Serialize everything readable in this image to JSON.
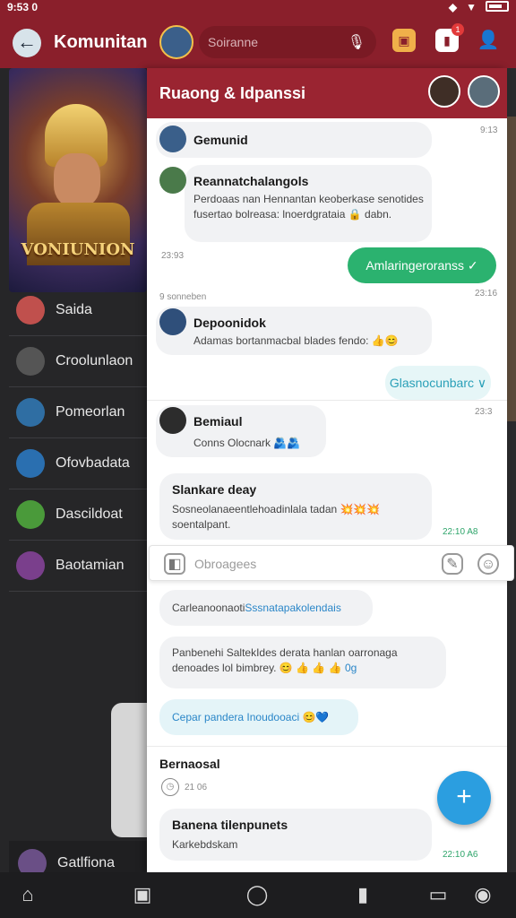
{
  "status_bar": {
    "time": "9:53 0"
  },
  "left": {
    "title": "Komunitan",
    "banner_title": "VONIUNION",
    "items": [
      {
        "label": "Saida",
        "color": "#c0504d"
      },
      {
        "label": "Croolunlaon",
        "color": "#555555"
      },
      {
        "label": "Pomeorlan",
        "color": "#2f6ea3"
      },
      {
        "label": "Ofovbadata",
        "color": "#2a6fb0"
      },
      {
        "label": "Dascildoat",
        "color": "#4a9a3a"
      },
      {
        "label": "Baotamian",
        "color": "#7a3f8c"
      }
    ],
    "bottom_label": "Gatlfiona"
  },
  "topbar": {
    "search_placeholder": "Soiranne",
    "notif_count": "1"
  },
  "chat": {
    "header_title": "Ruaong & Idpanssi",
    "messages": [
      {
        "name": "Gemunid",
        "text": "",
        "time": "9:13"
      },
      {
        "name": "Reannatchalangols",
        "text": "Perdoaas nan Hennantan keoberkase senotides fusertao bolreasa: lnoerdgrataia 🔒 dabn.",
        "time": "23:93"
      },
      {
        "action": "Amlaringeroranss ✓",
        "time": "23:16"
      },
      {
        "label": "9 sonneben"
      },
      {
        "name": "Depoonidok",
        "text": "Adamas bortanmacbal blades fendo: 👍😊"
      },
      {
        "action": "Glasnocunbarc ∨"
      },
      {
        "name": "Bemiaul",
        "text": "Conns Olocnark 🫂🫂",
        "time": "23:3"
      },
      {
        "name": "Slankare deay",
        "text": "Sosneolanaeentlehoadinlala tadan 💥💥💥 soentalpant.",
        "time": "22:10 A8"
      }
    ],
    "input_placeholder": "Obroagees",
    "replies": [
      {
        "text": "Carleanoonaoti",
        "link": "Sssnatapakolendais"
      },
      {
        "text": "Panbenehi SaltekIdes derata hanlan oarronaga denoades lol bimbrey. 😊 👍 👍 👍",
        "link": "0g"
      },
      {
        "text": "Cepar pandera Inoudooaci 😊💙"
      }
    ],
    "section_title": "Bernaosal",
    "section_time": "21 06",
    "last": {
      "name": "Banena tilenpunets",
      "text": "Karkebdskam",
      "time": "22:10 A6"
    }
  },
  "colors": {
    "brand": "#8a1f2b",
    "accent_green": "#2bb26f",
    "fab": "#2b9ee0"
  },
  "bottom_nav": [
    "home-icon",
    "chat-icon",
    "circle-icon",
    "bookmark-icon",
    "tv-icon",
    "shield-icon"
  ]
}
